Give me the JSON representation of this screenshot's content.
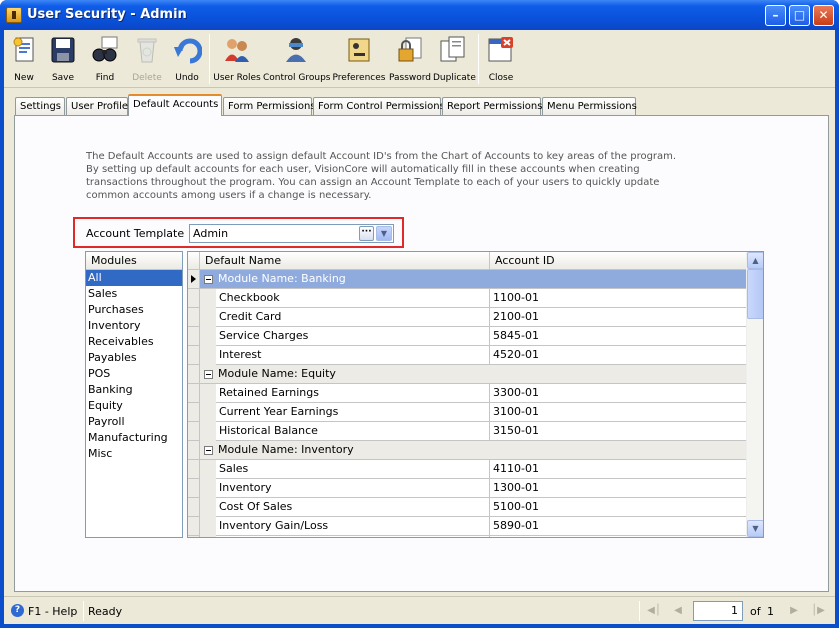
{
  "window": {
    "title": "User Security - Admin"
  },
  "toolbar": {
    "buttons": [
      {
        "label": "New",
        "icon": "new-document-icon"
      },
      {
        "label": "Save",
        "icon": "floppy-disk-icon"
      },
      {
        "label": "Find",
        "icon": "binoculars-icon"
      },
      {
        "label": "Delete",
        "icon": "recycle-bin-icon",
        "disabled": true
      },
      {
        "label": "Undo",
        "icon": "undo-arrow-icon"
      },
      {
        "label": "User Roles",
        "icon": "user-roles-icon"
      },
      {
        "label": "Control Groups",
        "icon": "control-groups-icon"
      },
      {
        "label": "Preferences",
        "icon": "preferences-icon"
      },
      {
        "label": "Password",
        "icon": "password-lock-icon"
      },
      {
        "label": "Duplicate",
        "icon": "duplicate-icon"
      },
      {
        "label": "Close",
        "icon": "close-form-icon"
      }
    ]
  },
  "tabs": [
    {
      "label": "Settings"
    },
    {
      "label": "User Profile"
    },
    {
      "label": "Default Accounts",
      "active": true
    },
    {
      "label": "Form Permissions"
    },
    {
      "label": "Form Control Permissions"
    },
    {
      "label": "Report Permissions"
    },
    {
      "label": "Menu Permissions"
    }
  ],
  "default_accounts": {
    "description": "The Default Accounts are used to assign default Account ID's from the Chart of Accounts to key areas of the program. By setting up default accounts for each user, VisionCore will automatically fill in these accounts when creating transactions throughout the program. You can assign an Account Template to each of your users to quickly update common accounts among users if a change is necessary.",
    "account_template": {
      "label": "Account Template",
      "value": "Admin",
      "ellipsis": "···"
    },
    "modules": {
      "header": "Modules",
      "items": [
        "All",
        "Sales",
        "Purchases",
        "Inventory",
        "Receivables",
        "Payables",
        "POS",
        "Banking",
        "Equity",
        "Payroll",
        "Manufacturing",
        "Misc"
      ],
      "selected": "All"
    },
    "grid": {
      "columns": [
        "Default Name",
        "Account ID"
      ],
      "groups": [
        {
          "title": "Module Name: Banking",
          "highlighted": true,
          "rows": [
            {
              "name": "Checkbook",
              "account": "1100-01"
            },
            {
              "name": "Credit Card",
              "account": "2100-01"
            },
            {
              "name": "Service Charges",
              "account": "5845-01"
            },
            {
              "name": "Interest",
              "account": "4520-01"
            }
          ]
        },
        {
          "title": "Module Name: Equity",
          "rows": [
            {
              "name": "Retained Earnings",
              "account": "3300-01"
            },
            {
              "name": "Current Year Earnings",
              "account": "3100-01"
            },
            {
              "name": "Historical Balance",
              "account": "3150-01"
            }
          ]
        },
        {
          "title": "Module Name: Inventory",
          "rows": [
            {
              "name": "Sales",
              "account": "4110-01"
            },
            {
              "name": "Inventory",
              "account": "1300-01"
            },
            {
              "name": "Cost Of Sales",
              "account": "5100-01"
            },
            {
              "name": "Inventory Gain/Loss",
              "account": "5890-01"
            }
          ]
        }
      ]
    }
  },
  "statusbar": {
    "help": "F1 - Help",
    "status": "Ready",
    "page": "1",
    "of_label": "of",
    "page_count": "1"
  },
  "colors": {
    "title_bar": "#0a52dc",
    "selected_row": "#316ac5",
    "group_highlight": "#8faadc",
    "highlight_box": "#e02a2a",
    "active_tab_accent": "#e68b2c"
  }
}
